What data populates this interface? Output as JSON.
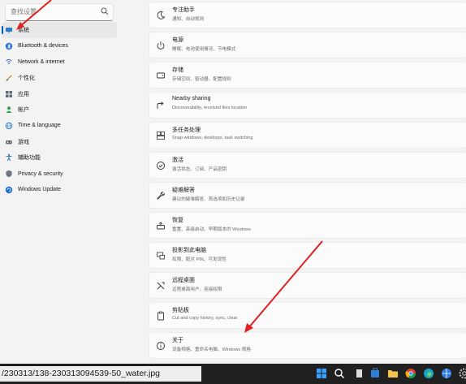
{
  "search": {
    "placeholder": "查找设置"
  },
  "sidebar": {
    "items": [
      {
        "label": "系统",
        "icon": "monitor-icon",
        "selected": true
      },
      {
        "label": "Bluetooth & devices",
        "icon": "bluetooth-icon"
      },
      {
        "label": "Network & internet",
        "icon": "network-icon"
      },
      {
        "label": "个性化",
        "icon": "brush-icon"
      },
      {
        "label": "应用",
        "icon": "apps-icon"
      },
      {
        "label": "帐户",
        "icon": "account-icon"
      },
      {
        "label": "Time & language",
        "icon": "globe-icon"
      },
      {
        "label": "游戏",
        "icon": "gamepad-icon"
      },
      {
        "label": "辅助功能",
        "icon": "accessibility-icon"
      },
      {
        "label": "Privacy & security",
        "icon": "shield-icon"
      },
      {
        "label": "Windows Update",
        "icon": "update-icon"
      }
    ]
  },
  "main": {
    "cards": [
      {
        "title": "专注助手",
        "subtitle": "通知、自动规则",
        "icon": "moon-icon"
      },
      {
        "title": "电源",
        "subtitle": "睡眠、电池使用情况、节电模式",
        "icon": "power-icon"
      },
      {
        "title": "存储",
        "subtitle": "存储空间、驱动器、配置规则",
        "icon": "storage-icon"
      },
      {
        "title": "Nearby sharing",
        "subtitle": "Discoverability, received files location",
        "icon": "share-icon"
      },
      {
        "title": "多任务处理",
        "subtitle": "Snap windows, desktops, task switching",
        "icon": "multitask-icon"
      },
      {
        "title": "激活",
        "subtitle": "激活状态、订阅、产品密钥",
        "icon": "check-circle-icon"
      },
      {
        "title": "疑难解答",
        "subtitle": "建议的疑难解答、首选项和历史记录",
        "icon": "wrench-icon"
      },
      {
        "title": "恢复",
        "subtitle": "重置、高级启动、早期版本的 Windows",
        "icon": "recovery-icon"
      },
      {
        "title": "投影到此电脑",
        "subtitle": "权限、配对 PIN、可发现性",
        "icon": "projection-icon"
      },
      {
        "title": "远程桌面",
        "subtitle": "远程桌面用户、连接权限",
        "icon": "remote-icon"
      },
      {
        "title": "剪贴板",
        "subtitle": "Cut and copy history, sync, clear",
        "icon": "clipboard-icon"
      },
      {
        "title": "关于",
        "subtitle": "设备规格、重命名电脑、Windows 规格",
        "icon": "info-icon"
      }
    ]
  },
  "overlay": {
    "filename": "/230313/138-230313094539-50_water.jpg"
  },
  "taskbar": {
    "icons": [
      "windows-start-icon",
      "search-icon",
      "file-explorer-icon",
      "store-icon",
      "folder-icon",
      "chrome-icon",
      "edge-icon",
      "browser-icon",
      "settings-icon"
    ]
  },
  "colors": {
    "accent": "#005fb8",
    "arrow": "#e02020",
    "taskbar": "#202020"
  }
}
